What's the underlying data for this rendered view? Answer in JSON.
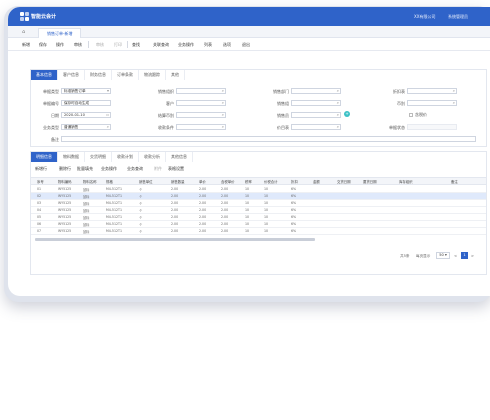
{
  "app": {
    "name": "智能云会计",
    "user": "系统管理员",
    "company": "XX有限公司"
  },
  "page_tab": "销售订单-新增",
  "toolbar": {
    "items": [
      "新增",
      "保存",
      "操作",
      "审核",
      "审核",
      "打印",
      "查找",
      "关联查询",
      "业务操作",
      "列表",
      "选项",
      "退出"
    ]
  },
  "header_tabs": [
    "基本信息",
    "客户信息",
    "财务信息",
    "订单条款",
    "物流跟踪",
    "其他"
  ],
  "form": {
    "fields": [
      {
        "label": "单据类型",
        "value": "标准销售订单"
      },
      {
        "label": "单据编号",
        "value": "保存时自动生成"
      },
      {
        "label": "日期",
        "value": "2020-01-10"
      },
      {
        "label": "业务类型",
        "value": "普通销售"
      },
      {
        "label": "备注",
        "value": ""
      },
      {
        "label": "销售组织",
        "value": ""
      },
      {
        "label": "客户",
        "value": ""
      },
      {
        "label": "结算币别",
        "value": ""
      },
      {
        "label": "收款条件",
        "value": ""
      },
      {
        "label": "销售部门",
        "value": ""
      },
      {
        "label": "销售组",
        "value": ""
      },
      {
        "label": "销售员",
        "value": ""
      },
      {
        "label": "价目表",
        "value": ""
      },
      {
        "label": "折扣表",
        "value": ""
      },
      {
        "label": "币别",
        "value": ""
      },
      {
        "label": "单据状态",
        "value": ""
      }
    ],
    "checkbox_label": "含税价"
  },
  "detail_tabs": [
    "明细信息",
    "物料数据",
    "交货明细",
    "收款计划",
    "收款分析",
    "其他信息"
  ],
  "detail_actions": [
    "新增行",
    "删除行",
    "批量填充",
    "业务操作",
    "业务查询",
    "附件",
    "表格设置"
  ],
  "grid": {
    "headers": [
      "序号",
      "物料编码",
      "物料名称",
      "规格",
      "销售单位",
      "销售数量",
      "单价",
      "含税单价",
      "税率",
      "价税合计",
      "折扣",
      "金额",
      "交货日期",
      "要货日期",
      "库存组织",
      "备注"
    ],
    "rows": [
      [
        "01",
        "WY5125",
        "鼠标",
        "M4-512T1",
        "个",
        "2.00",
        "2.00",
        "2.00",
        "10",
        "10",
        "6%"
      ],
      [
        "02",
        "WY5125",
        "鼠标",
        "M4-512T1",
        "个",
        "2.00",
        "2.00",
        "2.00",
        "10",
        "10",
        "6%"
      ],
      [
        "03",
        "WY5125",
        "鼠标",
        "M4-512T1",
        "个",
        "2.00",
        "2.00",
        "2.00",
        "10",
        "10",
        "6%"
      ],
      [
        "04",
        "WY5125",
        "鼠标",
        "M4-512T1",
        "个",
        "2.00",
        "2.00",
        "2.00",
        "10",
        "10",
        "6%"
      ],
      [
        "05",
        "WY5125",
        "鼠标",
        "M4-512T1",
        "个",
        "2.00",
        "2.00",
        "2.00",
        "10",
        "10",
        "6%"
      ],
      [
        "06",
        "WY5125",
        "鼠标",
        "M4-512T1",
        "个",
        "2.00",
        "2.00",
        "2.00",
        "10",
        "10",
        "6%"
      ],
      [
        "07",
        "WY5125",
        "鼠标",
        "M4-512T1",
        "个",
        "2.00",
        "2.00",
        "2.00",
        "10",
        "10",
        "6%"
      ]
    ],
    "selected_row": 1
  },
  "pager": {
    "total_label": "共5条",
    "per_page_label": "每页显示",
    "per_page": "50",
    "page": "1"
  },
  "colors": {
    "brand": "#2f63c9",
    "selected_row": "#dfe9fb"
  }
}
